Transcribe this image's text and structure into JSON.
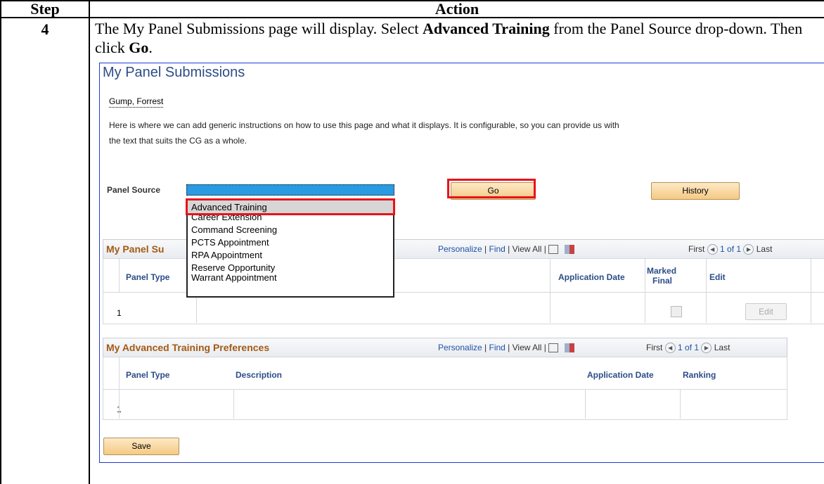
{
  "table": {
    "step_header": "Step",
    "action_header": "Action",
    "step_number": "4",
    "instruction_parts": [
      "The My Panel Submissions page will display. Select ",
      "Advanced Training",
      " from the Panel Source drop-down. Then click ",
      "Go",
      "."
    ]
  },
  "screen": {
    "title": "My Panel Submissions",
    "user_name": "Gump, Forrest",
    "instructions": "Here is where we can add generic instructions on how to use this page and what it displays. It is configurable, so you can provide us with the text that suits the CG as a whole.",
    "panel_source_label": "Panel Source",
    "go_button": "Go",
    "history_button": "History",
    "dropdown_options": [
      "Advanced Training",
      "Career Extension",
      "Command Screening",
      "PCTS Appointment",
      "RPA Appointment",
      "Reserve Opportunity",
      "Warrant Appointment"
    ],
    "grid1": {
      "title": "My Panel Su",
      "nav": {
        "personalize": "Personalize",
        "sep1": " | ",
        "find": "Find",
        "sep2": " | View All | ",
        "first": "First",
        "count": "1 of 1",
        "last": "Last"
      },
      "col_panel_type": "Panel Type",
      "col_application_date": "Application Date",
      "col_marked_final_1": "Marked",
      "col_marked_final_2": "Final",
      "col_edit": "Edit",
      "row_num": "1",
      "edit_button": "Edit"
    },
    "grid2": {
      "title": "My Advanced Training Preferences",
      "nav": {
        "personalize": "Personalize",
        "sep1": " | ",
        "find": "Find",
        "sep2": " | View All | ",
        "first": "First",
        "count": "1 of 1",
        "last": "Last"
      },
      "col_panel_type": "Panel Type",
      "col_description": "Description",
      "col_application_date": "Application Date",
      "col_ranking": "Ranking",
      "row_num": "1"
    },
    "save_button": "Save"
  },
  "colors": {
    "highlight_red": "#e8131b",
    "title_blue": "#2c4d87",
    "grid_title": "#a35a14",
    "dropdown_blue": "#2a9ae2"
  }
}
